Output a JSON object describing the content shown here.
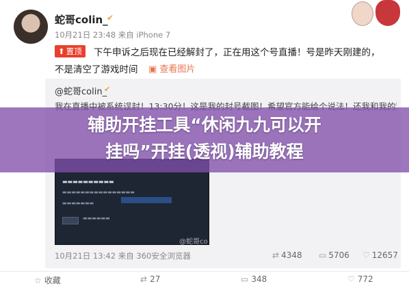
{
  "post": {
    "username": "蛇哥colin_",
    "meta": "10月21日 23:48 来自 iPhone 7",
    "pin_label": "置顶",
    "text_line1": "下午申诉之后现在已经解封了，正在用这个号直播！号是昨天刚建的，",
    "text_line2": "不是清空了游戏时间",
    "view_pic": "查看图片"
  },
  "repost": {
    "username": "@蛇哥colin_",
    "text": "我在直播中被系统误封！13:30分！这是我的封号截图！希望官方能给个说法！还我和我的观",
    "watermark": "@蛇哥co",
    "meta": "10月21日 13:42 来自 360安全浏览器",
    "stats": {
      "reposts": "4348",
      "comments": "5706",
      "likes": "12657"
    }
  },
  "overlay": {
    "title_line1": "辅助开挂工具“休闲九九可以开",
    "title_line2": "挂吗”开挂(透视)辅助教程"
  },
  "bottom": {
    "favorite": "收藏",
    "reposts": "27",
    "comments": "348",
    "likes": "772"
  },
  "icons": [
    "verified-badge-icon",
    "pin-icon",
    "image-icon",
    "repost-icon",
    "comment-icon",
    "like-icon",
    "star-icon"
  ]
}
